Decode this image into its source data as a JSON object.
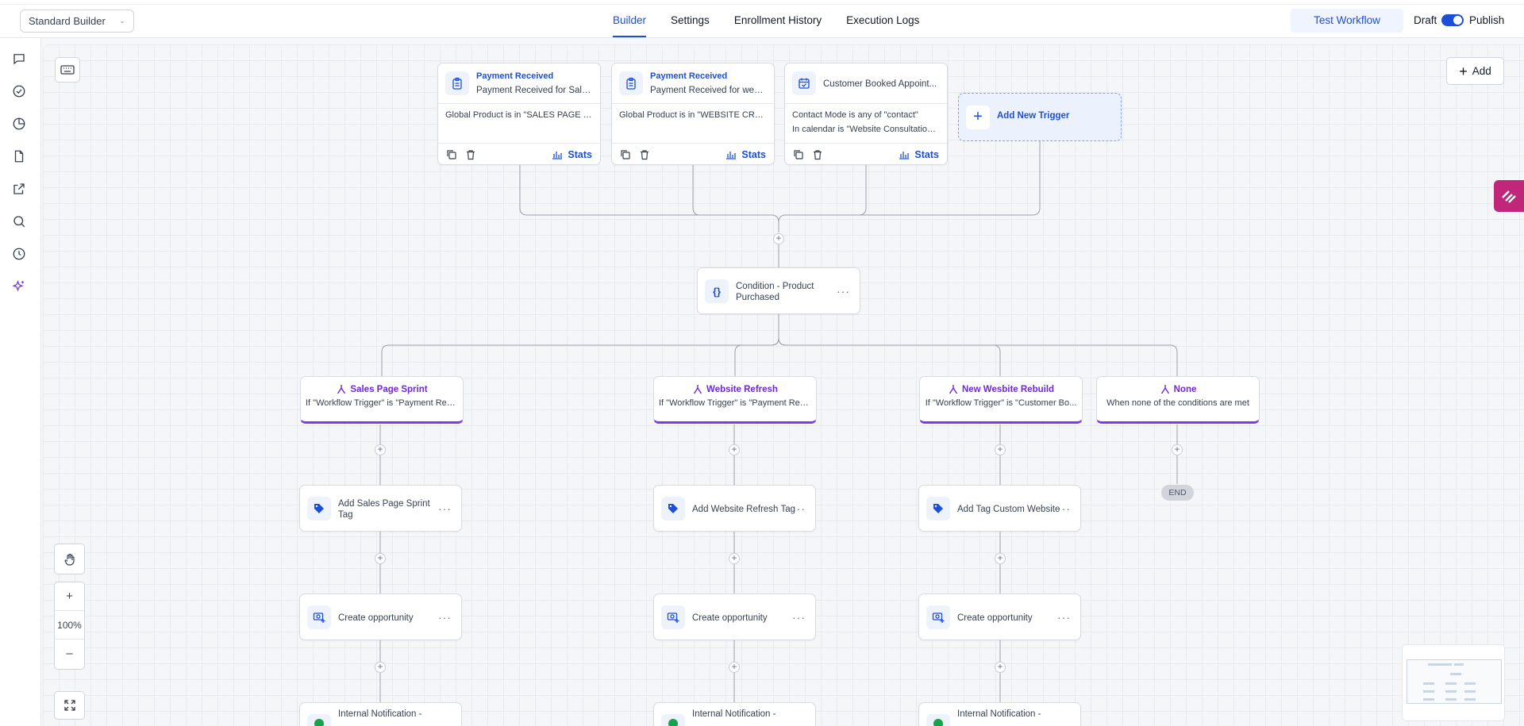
{
  "header": {
    "builder_select": "Standard Builder",
    "tabs": [
      {
        "label": "Builder",
        "active": true
      },
      {
        "label": "Settings",
        "active": false
      },
      {
        "label": "Enrollment History",
        "active": false
      },
      {
        "label": "Execution Logs",
        "active": false
      }
    ],
    "test_workflow": "Test Workflow",
    "draft": "Draft",
    "publish": "Publish",
    "publish_toggle_on": true
  },
  "toolbar": {
    "add_label": "Add"
  },
  "triggers": [
    {
      "title": "Payment Received",
      "subtitle": "Payment Received for Sales...",
      "filters": [
        "Global Product is in \"SALES PAGE S..."
      ],
      "stats": "Stats",
      "icon": "clipboard-icon"
    },
    {
      "title": "Payment Received",
      "subtitle": "Payment Received for webs...",
      "filters": [
        "Global Product is in \"WEBSITE CRED..."
      ],
      "stats": "Stats",
      "icon": "clipboard-icon"
    },
    {
      "title": "",
      "subtitle": "Customer Booked Appoint...",
      "filters": [
        "Contact Mode is any of \"contact\"",
        "In calendar is \"Website Consultation..."
      ],
      "stats": "Stats",
      "icon": "calendar-check-icon"
    }
  ],
  "add_trigger": "Add New Trigger",
  "condition": {
    "label": "Condition - Product Purchased",
    "line1": "Condition - Product",
    "line2": "Purchased"
  },
  "branches": [
    {
      "title": "Sales Page Sprint",
      "subtitle": "If \"Workflow Trigger\" is \"Payment Rec..."
    },
    {
      "title": "Website Refresh",
      "subtitle": "If \"Workflow Trigger\" is \"Payment Rec..."
    },
    {
      "title": "New Wesbite Rebuild",
      "subtitle": "If \"Workflow Trigger\" is \"Customer Bo..."
    },
    {
      "title": "None",
      "subtitle": "When none of the conditions are met"
    }
  ],
  "actions": {
    "tags": [
      {
        "line1": "Add Sales Page Sprint",
        "line2": "Tag"
      },
      {
        "line1": "Add Website Refresh Tag",
        "line2": ""
      },
      {
        "line1": "Add Tag Custom Website",
        "line2": ""
      }
    ],
    "opportunity": "Create opportunity",
    "notification": "Internal Notification -"
  },
  "end_label": "END",
  "zoom": "100%",
  "colors": {
    "accent": "#1d4ed8",
    "branch": "#7c3aed",
    "brand": "#c0267a"
  }
}
